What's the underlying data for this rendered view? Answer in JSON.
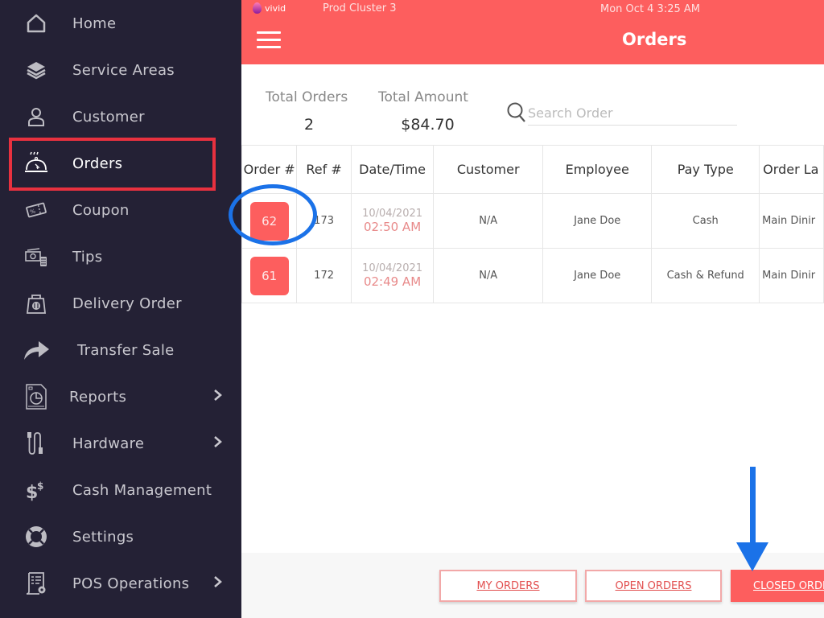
{
  "header": {
    "brand": "vivid",
    "cluster": "Prod Cluster 3",
    "datetime": "Mon Oct 4 3:25 AM",
    "title": "Orders",
    "accent_color": "#fd5e5e"
  },
  "sidebar": {
    "items": [
      {
        "label": "Home",
        "icon": "home-icon"
      },
      {
        "label": "Service Areas",
        "icon": "layers-icon"
      },
      {
        "label": "Customer",
        "icon": "user-icon"
      },
      {
        "label": "Orders",
        "icon": "cloche-icon",
        "active": true
      },
      {
        "label": "Coupon",
        "icon": "coupon-icon"
      },
      {
        "label": "Tips",
        "icon": "money-icon"
      },
      {
        "label": "Delivery Order",
        "icon": "bag-icon"
      },
      {
        "label": "Transfer Sale",
        "icon": "share-arrow-icon"
      },
      {
        "label": "Reports",
        "icon": "report-icon",
        "chevron": true
      },
      {
        "label": "Hardware",
        "icon": "cable-icon",
        "chevron": true
      },
      {
        "label": "Cash Management",
        "icon": "dollar-icon"
      },
      {
        "label": "Settings",
        "icon": "lifebuoy-icon"
      },
      {
        "label": "POS Operations",
        "icon": "pos-icon",
        "chevron": true
      }
    ]
  },
  "summary": {
    "total_orders_label": "Total Orders",
    "total_orders_value": "2",
    "total_amount_label": "Total Amount",
    "total_amount_value": "$84.70",
    "search_placeholder": "Search Order",
    "search_value": ""
  },
  "table": {
    "columns": [
      "Order #",
      "Ref #",
      "Date/Time",
      "Customer",
      "Employee",
      "Pay Type",
      "Order La"
    ],
    "rows": [
      {
        "order": "62",
        "ref": "173",
        "date": "10/04/2021",
        "time": "02:50 AM",
        "customer": "N/A",
        "employee": "Jane Doe",
        "pay_type": "Cash",
        "order_location": "Main Dinir"
      },
      {
        "order": "61",
        "ref": "172",
        "date": "10/04/2021",
        "time": "02:49 AM",
        "customer": "N/A",
        "employee": "Jane Doe",
        "pay_type": "Cash & Refund",
        "order_location": "Main Dinir"
      }
    ]
  },
  "footer": {
    "my_orders": "MY ORDERS",
    "open_orders": "OPEN ORDERS",
    "closed_orders": "CLOSED ORDERS"
  }
}
